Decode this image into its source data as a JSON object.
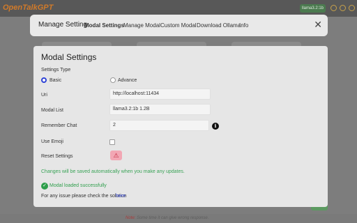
{
  "app": {
    "logo": "OpenTalkGPT",
    "model_chip": "llama3.2:1b",
    "footer_note_label": "Note:",
    "footer_note_text": " Some time it can give wrong response."
  },
  "modal": {
    "tabs": [
      {
        "label": "Manage Setting"
      },
      {
        "label": "Modal Settings"
      },
      {
        "label": "Manage Modal"
      },
      {
        "label": "Custom Modal"
      },
      {
        "label": "Download Ollama"
      },
      {
        "label": "Info"
      }
    ],
    "close_glyph": "✕"
  },
  "settings": {
    "title": "Modal Settings",
    "settings_type_label": "Settings Type",
    "type_options": [
      {
        "label": "Basic",
        "checked": true
      },
      {
        "label": "Advance",
        "checked": false
      }
    ],
    "uri_label": "Uri",
    "uri_value": "http://localhost:11434",
    "modal_list_label": "Modal List",
    "modal_list_value": "llama3.2:1b 1.2B",
    "remember_chat_label": "Remember Chat",
    "remember_chat_value": "2",
    "info_glyph": "i",
    "use_emoji_label": "Use Emoji",
    "reset_label": "Reset Settings",
    "reset_glyph": "⚠",
    "auto_save_note": "Changes will be saved automatically when you make any updates.",
    "status_glyph": "✓",
    "status_text": "Modal loaded successfully",
    "issue_text": "For any issue please check the solution",
    "issue_link": "here"
  },
  "colors": {
    "accent": "#2f43d6",
    "success": "#2e9e4b",
    "danger": "#c02038"
  }
}
